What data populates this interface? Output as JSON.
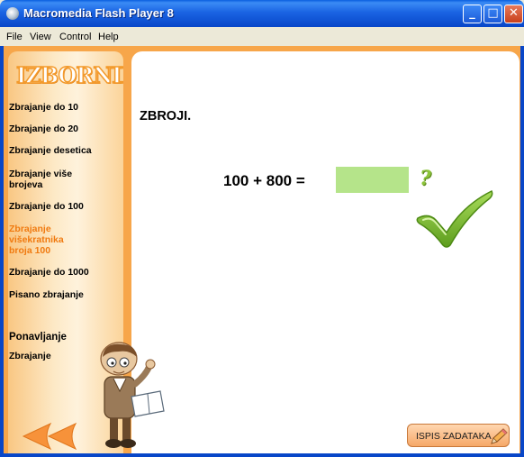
{
  "window": {
    "title": "Macromedia Flash Player 8",
    "controls": {
      "minimize": "_",
      "maximize": "□",
      "close": "✕"
    }
  },
  "menu": [
    "File",
    "View",
    "Control",
    "Help"
  ],
  "sidebar": {
    "logo": "IZBORNIK",
    "items": [
      "Zbrajanje do 10",
      "Zbrajanje do 20",
      "Zbrajanje desetica",
      "Zbrajanje više brojeva",
      "Zbrajanje do 100",
      "Zbrajanje višekratnika broja 100",
      "Zbrajanje do 1000",
      "Pisano zbrajanje"
    ],
    "active_index": 5,
    "extra_items": [
      "Ponavljanje",
      "Zbrajanje"
    ]
  },
  "main": {
    "heading": "ZBROJI.",
    "equation": "100 + 800 =",
    "answer_value": "",
    "help_icon": "?",
    "print_button": "ISPIS ZADATAKA"
  },
  "colors": {
    "accent_orange": "#f07a10",
    "answer_field": "#b5e48a",
    "check_green": "#8cc43a"
  },
  "icons": [
    "help-icon",
    "checkmark-icon",
    "back-arrows-icon",
    "teacher-character",
    "pencil-icon"
  ]
}
